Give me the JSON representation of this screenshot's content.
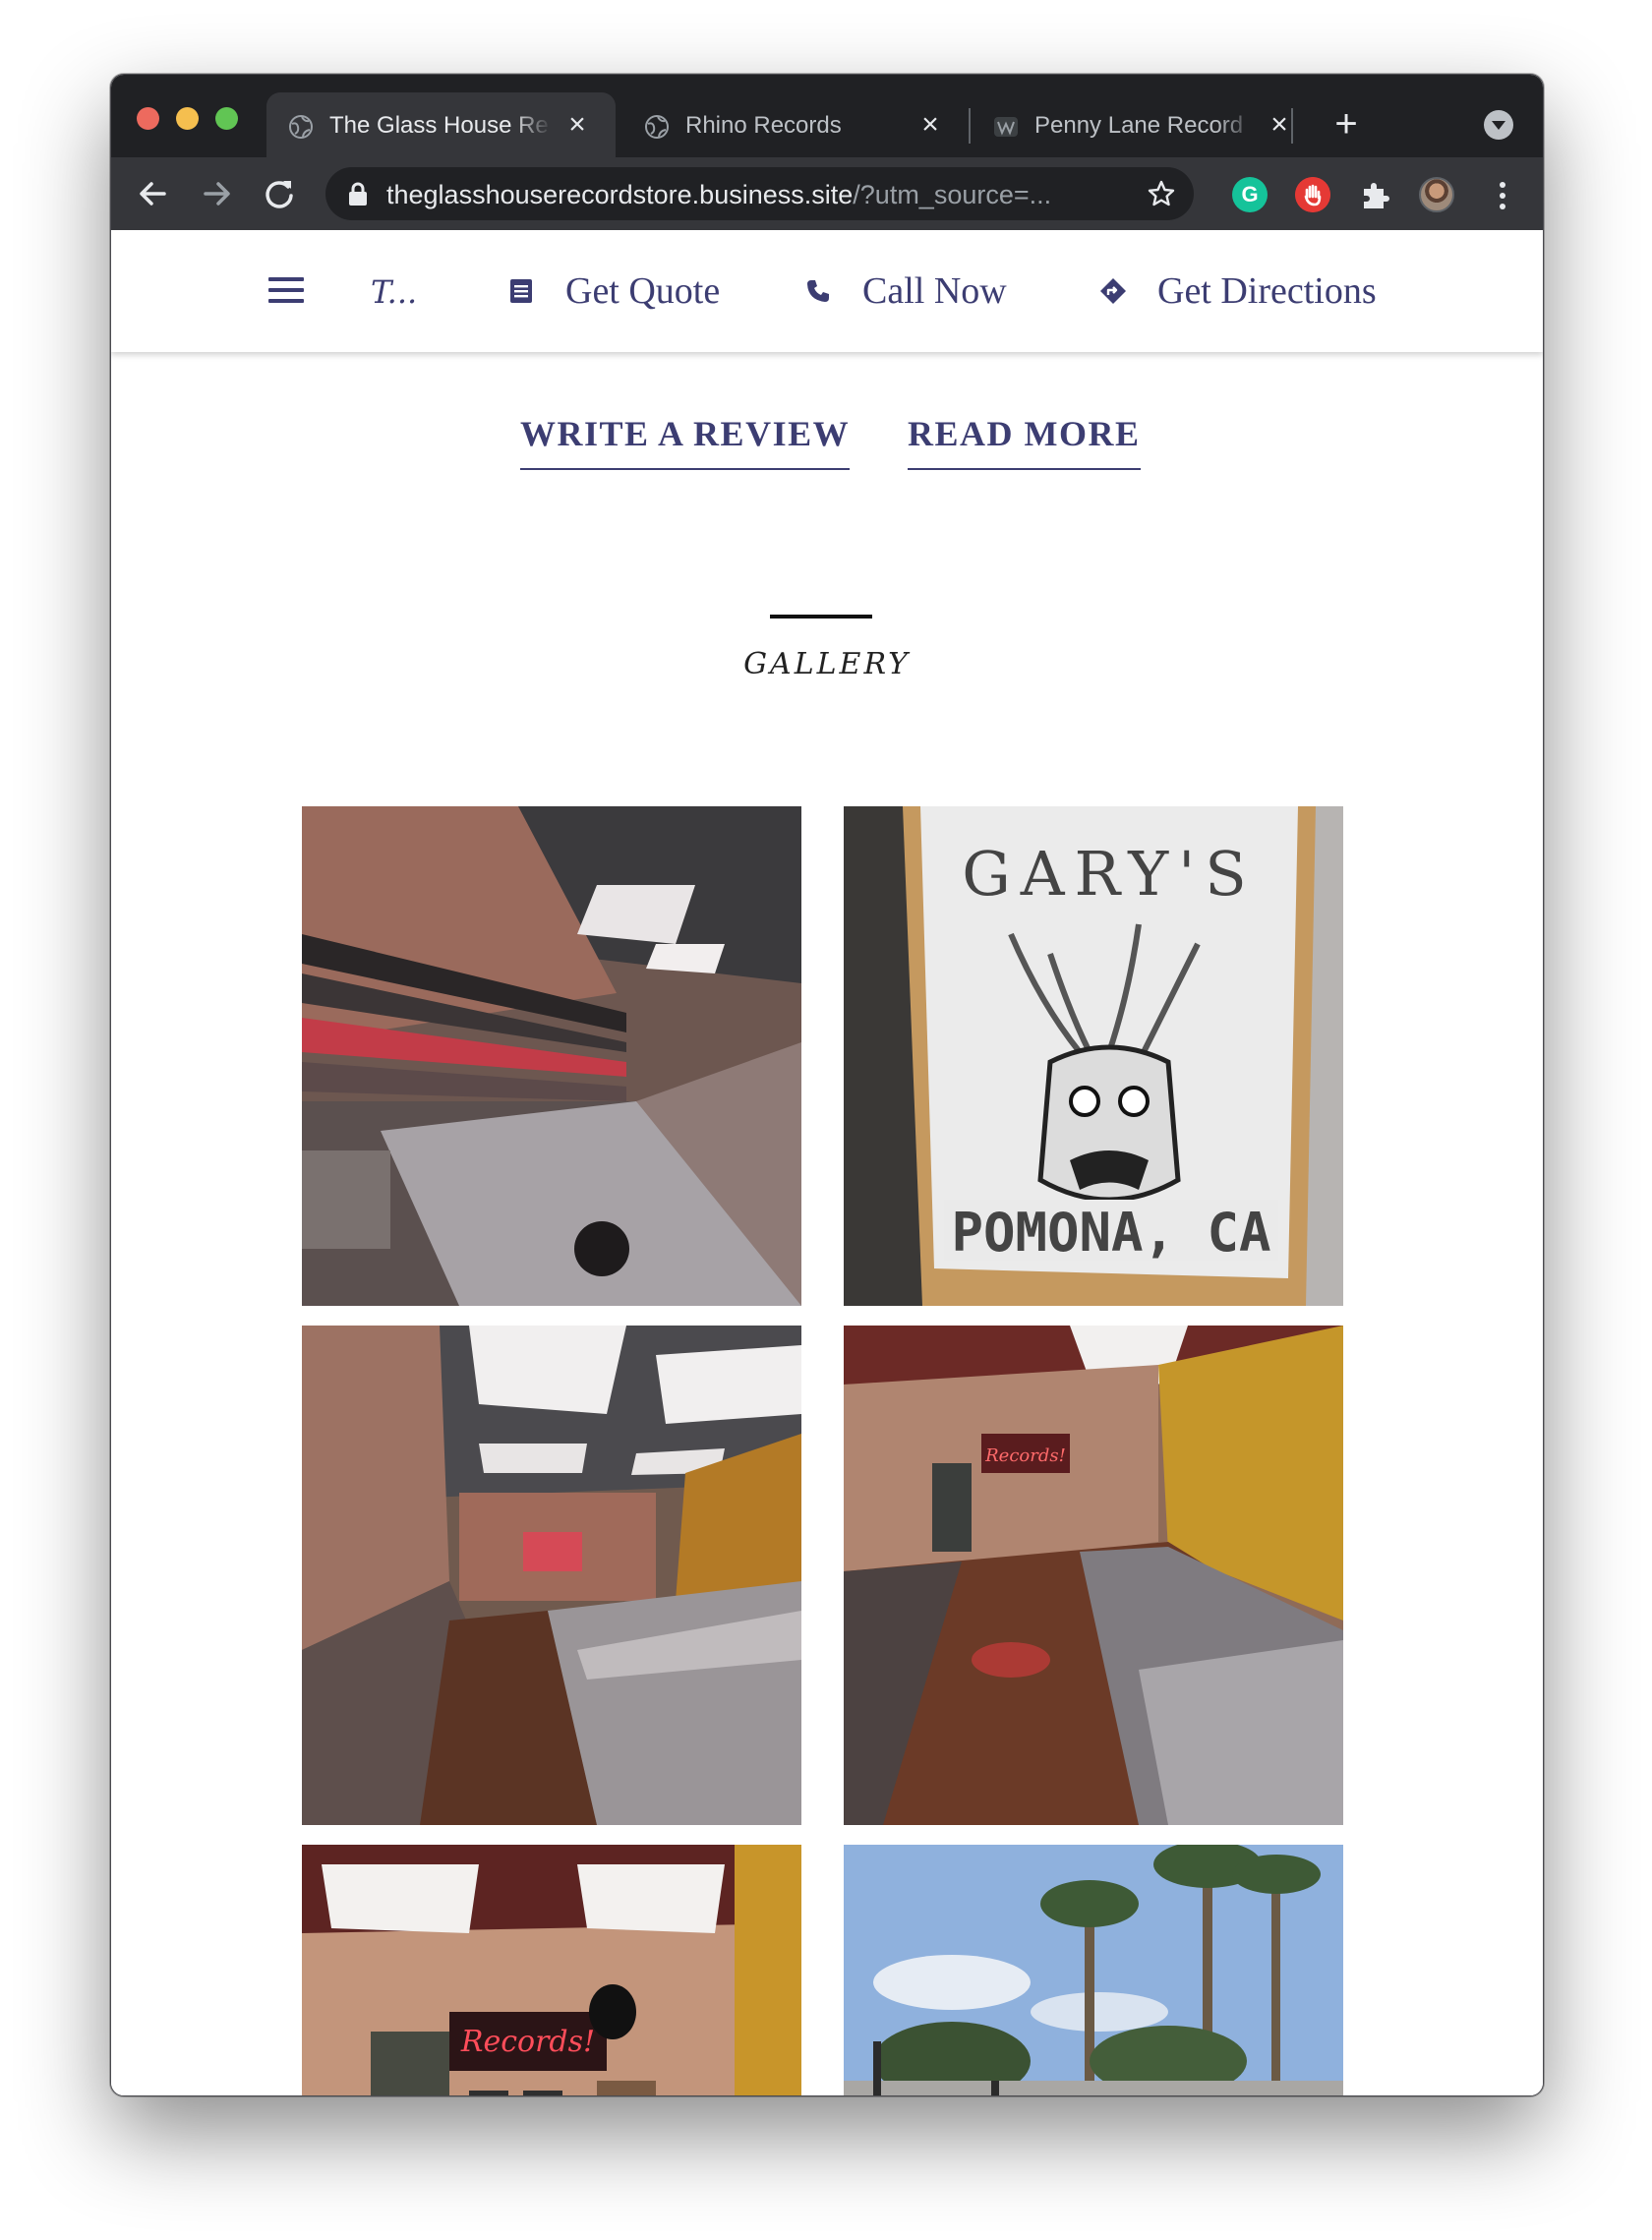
{
  "browser": {
    "tabs": [
      {
        "title": "The Glass House Re",
        "active": true
      },
      {
        "title": "Rhino Records",
        "active": false
      },
      {
        "title": "Penny Lane Record",
        "active": false
      }
    ],
    "url": {
      "host": "theglasshouserecordstore.business.site",
      "rest": "/?utm_source=..."
    },
    "extensions": [
      "grammarly-icon",
      "block-icon",
      "puzzle-icon",
      "avatar"
    ],
    "colors": {
      "tabstrip": "#202124",
      "toolbar": "#35363a"
    }
  },
  "site": {
    "brand": "T...",
    "nav": {
      "quote": "Get Quote",
      "call": "Call Now",
      "directions": "Get Directions"
    },
    "links": {
      "write_review": "WRITE A REVIEW",
      "read_more": "READ MORE"
    },
    "gallery_title": "GALLERY",
    "photo_texts": {
      "sign_top": "GARY'S",
      "sign_bottom": "POMONA, CA",
      "neon": "Records!"
    },
    "colors": {
      "accent": "#3c3d72"
    }
  }
}
